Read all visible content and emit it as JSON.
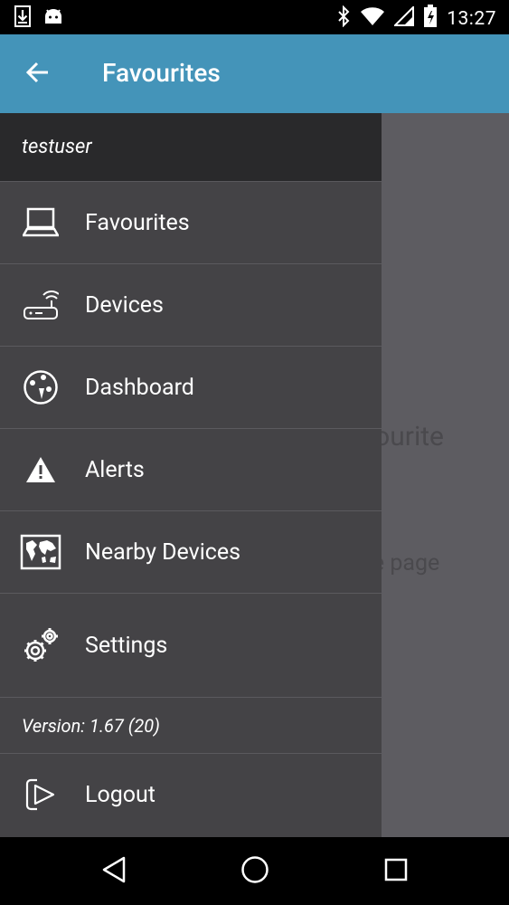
{
  "status_bar": {
    "time": "13:27"
  },
  "app_bar": {
    "title": "Favourites"
  },
  "empty_state": {
    "face": ":(",
    "message": "You haven't saved any favourite devices.",
    "hint": "Look for this icon on the device page"
  },
  "drawer": {
    "username": "testuser",
    "items": [
      {
        "label": "Favourites",
        "icon": "laptop-icon"
      },
      {
        "label": "Devices",
        "icon": "router-icon"
      },
      {
        "label": "Dashboard",
        "icon": "dashboard-icon"
      },
      {
        "label": "Alerts",
        "icon": "warning-icon"
      },
      {
        "label": "Nearby Devices",
        "icon": "world-map-icon"
      },
      {
        "label": "Settings",
        "icon": "gears-icon"
      }
    ],
    "version": "Version: 1.67 (20)",
    "logout_label": "Logout"
  },
  "colors": {
    "app_bar": "#4494b9",
    "drawer": "#444346",
    "drawer_header": "#29292b",
    "content": "#5d5c61"
  }
}
